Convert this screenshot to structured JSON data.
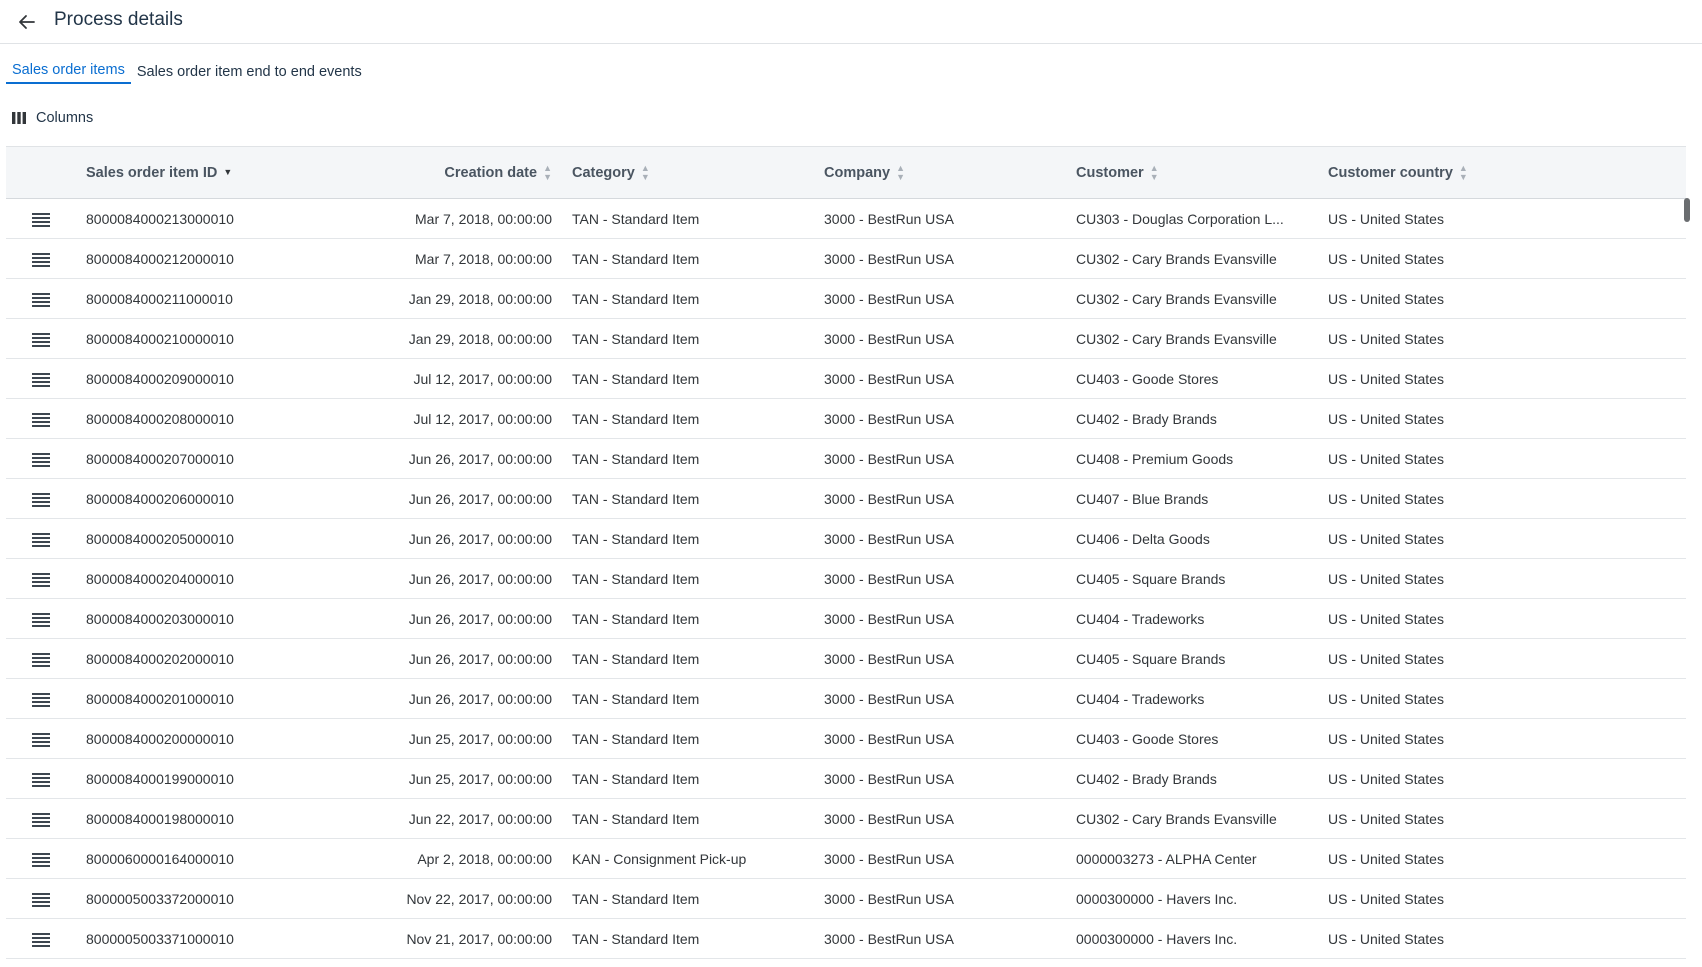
{
  "header": {
    "title": "Process details"
  },
  "tabs": [
    {
      "label": "Sales order items",
      "active": true
    },
    {
      "label": "Sales order item end to end events",
      "active": false
    }
  ],
  "toolbar": {
    "columns_label": "Columns"
  },
  "table": {
    "columns": [
      {
        "label": "Sales order item ID",
        "sort": "desc"
      },
      {
        "label": "Creation date",
        "sort": "none"
      },
      {
        "label": "Category",
        "sort": "none"
      },
      {
        "label": "Company",
        "sort": "none"
      },
      {
        "label": "Customer",
        "sort": "none"
      },
      {
        "label": "Customer country",
        "sort": "none"
      }
    ],
    "rows": [
      [
        "8000084000213000010",
        "Mar 7, 2018, 00:00:00",
        "TAN - Standard Item",
        "3000 - BestRun USA",
        "CU303 - Douglas Corporation L...",
        "US - United States"
      ],
      [
        "8000084000212000010",
        "Mar 7, 2018, 00:00:00",
        "TAN - Standard Item",
        "3000 - BestRun USA",
        "CU302 - Cary Brands Evansville",
        "US - United States"
      ],
      [
        "8000084000211000010",
        "Jan 29, 2018, 00:00:00",
        "TAN - Standard Item",
        "3000 - BestRun USA",
        "CU302 - Cary Brands Evansville",
        "US - United States"
      ],
      [
        "8000084000210000010",
        "Jan 29, 2018, 00:00:00",
        "TAN - Standard Item",
        "3000 - BestRun USA",
        "CU302 - Cary Brands Evansville",
        "US - United States"
      ],
      [
        "8000084000209000010",
        "Jul 12, 2017, 00:00:00",
        "TAN - Standard Item",
        "3000 - BestRun USA",
        "CU403 - Goode Stores",
        "US - United States"
      ],
      [
        "8000084000208000010",
        "Jul 12, 2017, 00:00:00",
        "TAN - Standard Item",
        "3000 - BestRun USA",
        "CU402 - Brady Brands",
        "US - United States"
      ],
      [
        "8000084000207000010",
        "Jun 26, 2017, 00:00:00",
        "TAN - Standard Item",
        "3000 - BestRun USA",
        "CU408 - Premium Goods",
        "US - United States"
      ],
      [
        "8000084000206000010",
        "Jun 26, 2017, 00:00:00",
        "TAN - Standard Item",
        "3000 - BestRun USA",
        "CU407 - Blue Brands",
        "US - United States"
      ],
      [
        "8000084000205000010",
        "Jun 26, 2017, 00:00:00",
        "TAN - Standard Item",
        "3000 - BestRun USA",
        "CU406 - Delta Goods",
        "US - United States"
      ],
      [
        "8000084000204000010",
        "Jun 26, 2017, 00:00:00",
        "TAN - Standard Item",
        "3000 - BestRun USA",
        "CU405 - Square Brands",
        "US - United States"
      ],
      [
        "8000084000203000010",
        "Jun 26, 2017, 00:00:00",
        "TAN - Standard Item",
        "3000 - BestRun USA",
        "CU404 - Tradeworks",
        "US - United States"
      ],
      [
        "8000084000202000010",
        "Jun 26, 2017, 00:00:00",
        "TAN - Standard Item",
        "3000 - BestRun USA",
        "CU405 - Square Brands",
        "US - United States"
      ],
      [
        "8000084000201000010",
        "Jun 26, 2017, 00:00:00",
        "TAN - Standard Item",
        "3000 - BestRun USA",
        "CU404 - Tradeworks",
        "US - United States"
      ],
      [
        "8000084000200000010",
        "Jun 25, 2017, 00:00:00",
        "TAN - Standard Item",
        "3000 - BestRun USA",
        "CU403 - Goode Stores",
        "US - United States"
      ],
      [
        "8000084000199000010",
        "Jun 25, 2017, 00:00:00",
        "TAN - Standard Item",
        "3000 - BestRun USA",
        "CU402 - Brady Brands",
        "US - United States"
      ],
      [
        "8000084000198000010",
        "Jun 22, 2017, 00:00:00",
        "TAN - Standard Item",
        "3000 - BestRun USA",
        "CU302 - Cary Brands Evansville",
        "US - United States"
      ],
      [
        "8000060000164000010",
        "Apr 2, 2018, 00:00:00",
        "KAN - Consignment Pick-up",
        "3000 - BestRun USA",
        "0000003273 - ALPHA Center",
        "US - United States"
      ],
      [
        "8000005003372000010",
        "Nov 22, 2017, 00:00:00",
        "TAN - Standard Item",
        "3000 - BestRun USA",
        "0000300000 - Havers Inc.",
        "US - United States"
      ],
      [
        "8000005003371000010",
        "Nov 21, 2017, 00:00:00",
        "TAN - Standard Item",
        "3000 - BestRun USA",
        "0000300000 - Havers Inc.",
        "US - United States"
      ]
    ]
  },
  "colors": {
    "accent": "#0a6ed1",
    "header_bg": "#f4f6f8",
    "text": "#32363a"
  },
  "icons": {
    "back": "arrow-left-icon",
    "columns": "columns-icon",
    "row_menu": "hamburger-menu-icon",
    "sort": "sort-icon"
  }
}
